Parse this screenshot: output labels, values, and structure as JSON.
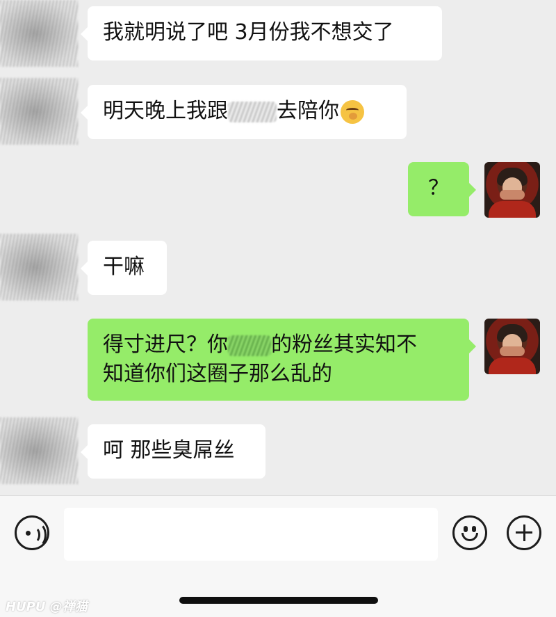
{
  "messages": [
    {
      "side": "left",
      "text": "我就明说了吧 3月份我不想交了"
    },
    {
      "side": "left",
      "text_before": "明天晚上我跟",
      "text_after": "去陪你",
      "emoji": "yawning-face-emoji"
    },
    {
      "side": "right",
      "text": "？"
    },
    {
      "side": "left",
      "text": "干嘛"
    },
    {
      "side": "right",
      "line1_before": "得寸进尺？你",
      "line1_after": "的粉丝其实知不",
      "line2": "知道你们这圈子那么乱的"
    },
    {
      "side": "left",
      "text": "呵 那些臭屌丝"
    }
  ],
  "input_bar": {
    "text_value": "",
    "placeholder": "",
    "voice_icon": "voice-icon",
    "emoji_icon": "emoji-icon",
    "add_icon": "plus-icon"
  },
  "watermark": "HUPU @禅猫",
  "colors": {
    "background": "#ededed",
    "received_bubble": "#ffffff",
    "sent_bubble": "#95ec69",
    "input_bar": "#f7f7f7"
  }
}
